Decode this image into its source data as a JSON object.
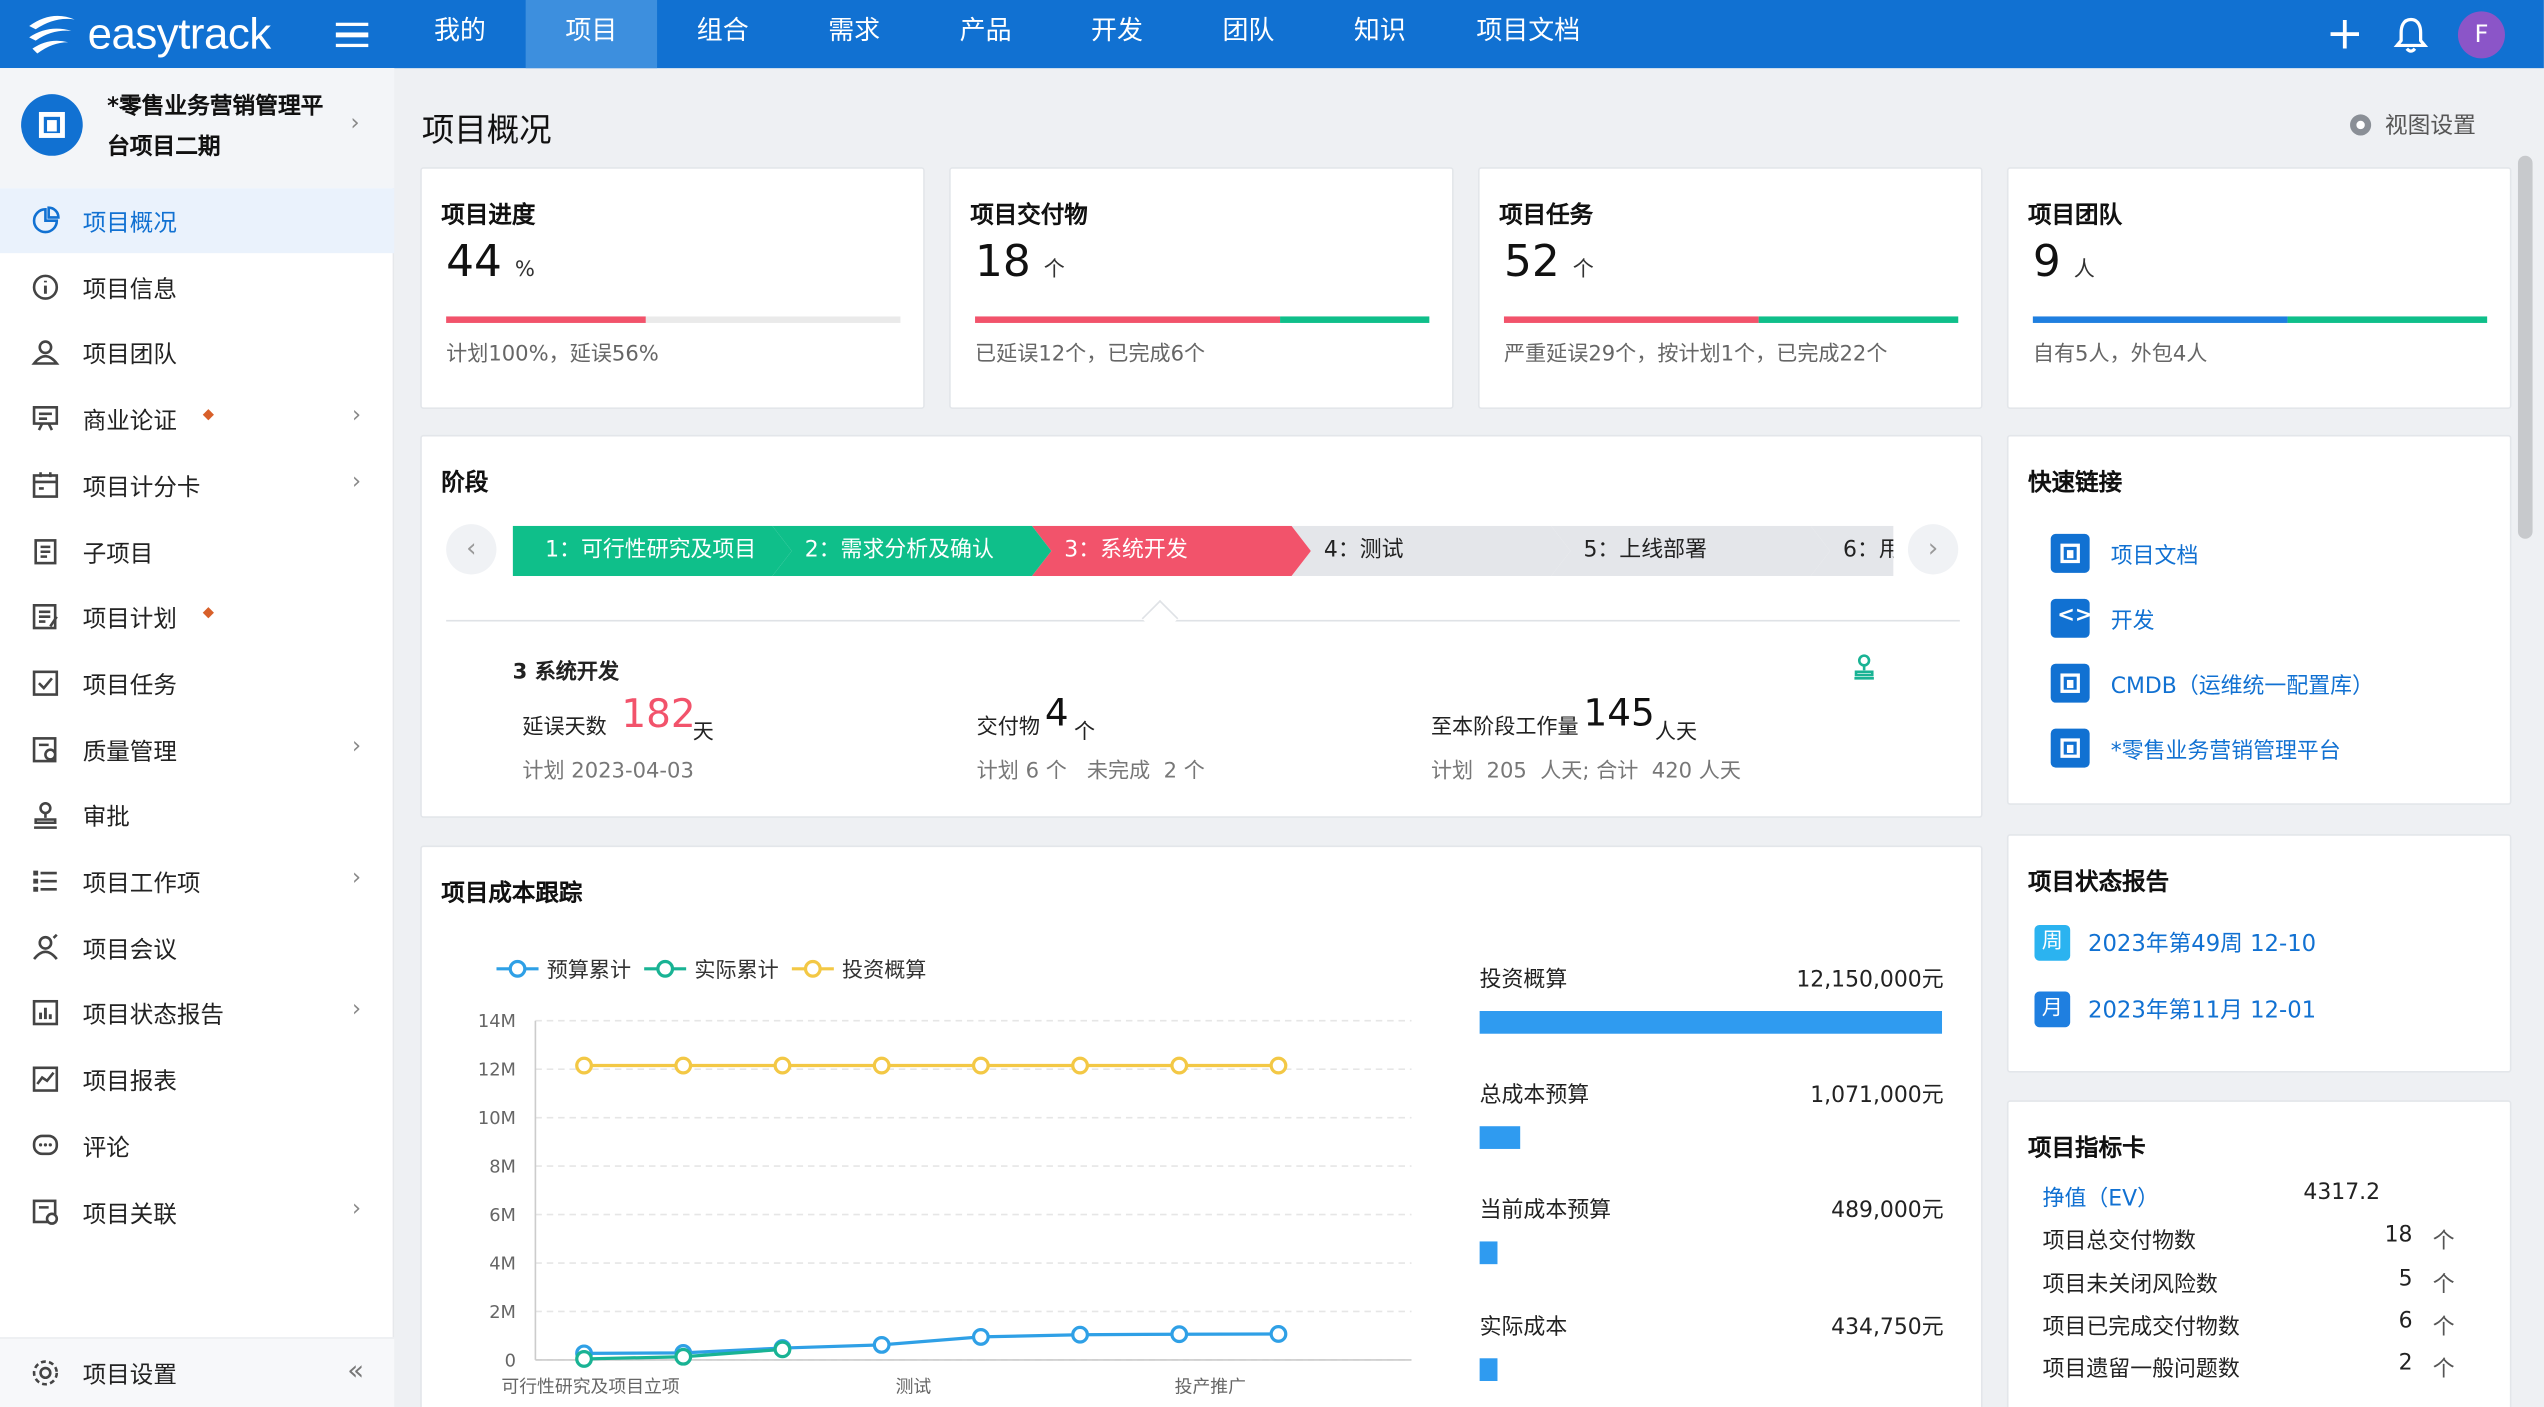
{
  "app": {
    "logo_text": "easytrack"
  },
  "nav": {
    "items": [
      {
        "label": "我的",
        "width": 81
      },
      {
        "label": "项目",
        "width": 81
      },
      {
        "label": "组合",
        "width": 81
      },
      {
        "label": "需求",
        "width": 81
      },
      {
        "label": "产品",
        "width": 81
      },
      {
        "label": "开发",
        "width": 81
      },
      {
        "label": "团队",
        "width": 81
      },
      {
        "label": "知识",
        "width": 81
      },
      {
        "label": "项目文档",
        "width": 102
      }
    ],
    "active": "项目"
  },
  "user": {
    "avatar_letter": "F"
  },
  "project": {
    "name": "*零售业务营销管理平台项目二期"
  },
  "sidebar": {
    "items": [
      {
        "label": "项目概况",
        "icon": "pie-chart-icon"
      },
      {
        "label": "项目信息",
        "icon": "info-icon"
      },
      {
        "label": "项目团队",
        "icon": "team-icon"
      },
      {
        "label": "商业论证",
        "icon": "presentation-icon"
      },
      {
        "label": "项目计分卡",
        "icon": "scorecard-icon"
      },
      {
        "label": "子项目",
        "icon": "document-icon"
      },
      {
        "label": "项目计划",
        "icon": "plan-icon"
      },
      {
        "label": "项目任务",
        "icon": "task-checkbox-icon"
      },
      {
        "label": "质量管理",
        "icon": "quality-icon"
      },
      {
        "label": "审批",
        "icon": "stamp-icon"
      },
      {
        "label": "项目工作项",
        "icon": "list-icon"
      },
      {
        "label": "项目会议",
        "icon": "meeting-icon"
      },
      {
        "label": "项目状态报告",
        "icon": "report-icon"
      },
      {
        "label": "项目报表",
        "icon": "line-chart-icon"
      },
      {
        "label": "评论",
        "icon": "comment-icon"
      },
      {
        "label": "项目关联",
        "icon": "link-icon"
      }
    ],
    "settings_label": "项目设置"
  },
  "page": {
    "title": "项目概况",
    "view_settings": "视图设置"
  },
  "stats": [
    {
      "title": "项目进度",
      "value": "44",
      "unit": "%",
      "note": "计划100%，延误56%"
    },
    {
      "title": "项目交付物",
      "value": "18",
      "unit": "个",
      "note": "已延误12个，已完成6个"
    },
    {
      "title": "项目任务",
      "value": "52",
      "unit": "个",
      "note": "严重延误29个，按计划1个，已完成22个"
    },
    {
      "title": "项目团队",
      "value": "9",
      "unit": "人",
      "note": "自有5人，外包4人"
    }
  ],
  "stage_section": {
    "title": "阶段",
    "stages": [
      "1：可行性研究及项目",
      "2：需求分析及确认",
      "3：系统开发",
      "4：测试",
      "5：上线部署",
      "6：用"
    ],
    "current_title": "3 系统开发",
    "delay_label": "延误天数",
    "delay_value": "182",
    "delay_unit": "天",
    "plan_date": "计划 2023-04-03",
    "deliv_label": "交付物",
    "deliv_value": "4",
    "deliv_unit": "个",
    "deliv_note": "计划 6 个   未完成  2 个",
    "effort_label": "至本阶段工作量",
    "effort_value": "145",
    "effort_unit": "人天",
    "effort_note": "计划  205  人天; 合计  420 人天"
  },
  "cost": {
    "title": "项目成本跟踪",
    "legend": [
      "预算累计",
      "实际累计",
      "投资概算"
    ],
    "rows": [
      {
        "label": "投资概算",
        "value": "12,150,000元",
        "amount": 12150000
      },
      {
        "label": "总成本预算",
        "value": "1,071,000元",
        "amount": 1071000
      },
      {
        "label": "当前成本预算",
        "value": "489,000元",
        "amount": 489000
      },
      {
        "label": "实际成本",
        "value": "434,750元",
        "amount": 434750
      }
    ]
  },
  "chart_data": {
    "type": "line",
    "title": "",
    "xlabel": "",
    "ylabel": "",
    "x_tick_labels": [
      "可行性研究及项目立项",
      "测试",
      "投产推广"
    ],
    "x": [
      1,
      2,
      3,
      4,
      5,
      6,
      7,
      8
    ],
    "y_tick_labels": [
      "0",
      "2M",
      "4M",
      "6M",
      "8M",
      "10M",
      "12M",
      "14M"
    ],
    "ylim": [
      0,
      14000000
    ],
    "grid": true,
    "legend_position": "top-left",
    "series": [
      {
        "name": "预算累计",
        "color": "#2fa0e6",
        "values": [
          270000,
          290000,
          489000,
          620000,
          950000,
          1040000,
          1060000,
          1071000
        ]
      },
      {
        "name": "实际累计",
        "color": "#19b394",
        "values": [
          40000,
          130000,
          434750,
          null,
          null,
          null,
          null,
          null
        ]
      },
      {
        "name": "投资概算",
        "color": "#f3c845",
        "values": [
          12150000,
          12150000,
          12150000,
          12150000,
          12150000,
          12150000,
          12150000,
          12150000
        ]
      }
    ]
  },
  "quick_links": {
    "title": "快速链接",
    "items": [
      {
        "label": "项目文档",
        "icon": "document-icon"
      },
      {
        "label": "开发",
        "icon": "code-icon"
      },
      {
        "label": "CMDB（运维统一配置库）",
        "icon": "database-icon"
      },
      {
        "label": "*零售业务营销管理平台",
        "icon": "project-icon"
      }
    ]
  },
  "status_report": {
    "title": "项目状态报告",
    "items": [
      {
        "badge": "周",
        "label": "2023年第49周 12-10",
        "color": "#2bb3f0"
      },
      {
        "badge": "月",
        "label": "2023年第11月 12-01",
        "color": "#1f7fe0"
      }
    ]
  },
  "kpi": {
    "title": "项目指标卡",
    "items": [
      {
        "label": "挣值（EV）",
        "value": "4317.2",
        "unit": ""
      },
      {
        "label": "项目总交付物数",
        "value": "18",
        "unit": "个"
      },
      {
        "label": "项目未关闭风险数",
        "value": "5",
        "unit": "个"
      },
      {
        "label": "项目已完成交付物数",
        "value": "6",
        "unit": "个"
      },
      {
        "label": "项目遗留一般问题数",
        "value": "2",
        "unit": "个"
      }
    ]
  },
  "colors": {
    "primary": "#1171d2",
    "stage_done": "#0fbf8a",
    "stage_current": "#f2536b",
    "stage_todo": "#e4e6ea",
    "delay_red": "#f2536b"
  }
}
